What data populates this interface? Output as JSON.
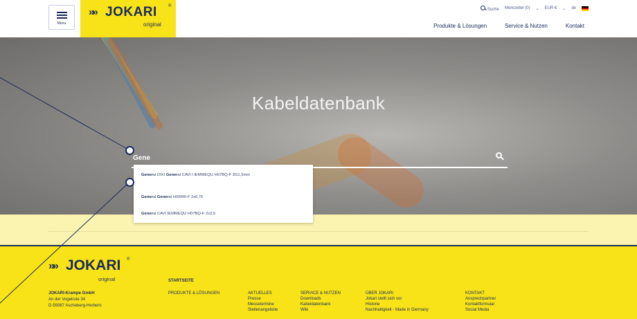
{
  "header": {
    "menu_label": "Menu",
    "logo": {
      "chevrons": "»»",
      "word": "JOKARI",
      "reg": "®",
      "sub": "original"
    },
    "topbar": {
      "search": "Suche",
      "watchlist": "Merkzettel (0)",
      "currency": "EUR €",
      "lang": "de"
    },
    "nav": [
      "Produkte & Lösungen",
      "Service & Nutzen",
      "Kontakt"
    ]
  },
  "hero": {
    "title": "Kabeldatenbank",
    "search_value": "Gene",
    "suggestions": [
      {
        "bold1": "Gener",
        "rest1": "al DIXI ",
        "bold2": "Gener",
        "rest2": "al CAVI l IEMMEQU H07BQ-F 3G1,5mm"
      },
      {
        "bold1": "Gener",
        "rest1": "al ",
        "bold2": "Gener",
        "rest2": "al H05RR-F 2x0,75"
      },
      {
        "bold1": "Gener",
        "rest1": "al CAVI IEMMEQU H07BQ-F 2x2,5",
        "bold2": "",
        "rest2": ""
      }
    ]
  },
  "footer": {
    "logo": {
      "chevrons": "»»",
      "word": "JOKARI",
      "reg": "®",
      "sub": "original"
    },
    "address": [
      "JOKARI-Krampe GmbH",
      "An der Vogelrute 34",
      "D-59387 Ascheberg-Herbern"
    ],
    "startseite": "STARTSEITE",
    "columns": [
      {
        "head": "PRODUKTE & LÖSUNGEN",
        "items": []
      },
      {
        "head": "AKTUELLES",
        "items": [
          "Presse",
          "Messetermine",
          "Stellenangebote"
        ]
      },
      {
        "head": "SERVICE & NUTZEN",
        "items": [
          "Downloads",
          "Kabeldatenbank",
          "Wiki"
        ]
      },
      {
        "head": "ÜBER JOKARI",
        "items": [
          "Jokari stellt sich vor",
          "Historie",
          "Nachhaltigkeit - Made in Germany"
        ]
      },
      {
        "head": "KONTAKT",
        "items": [
          "Ansprechpartner",
          "Kontaktformular",
          "Social Media"
        ]
      }
    ]
  },
  "colors": {
    "brand_yellow": "#f8e318",
    "brand_navy": "#1a2a5a"
  }
}
